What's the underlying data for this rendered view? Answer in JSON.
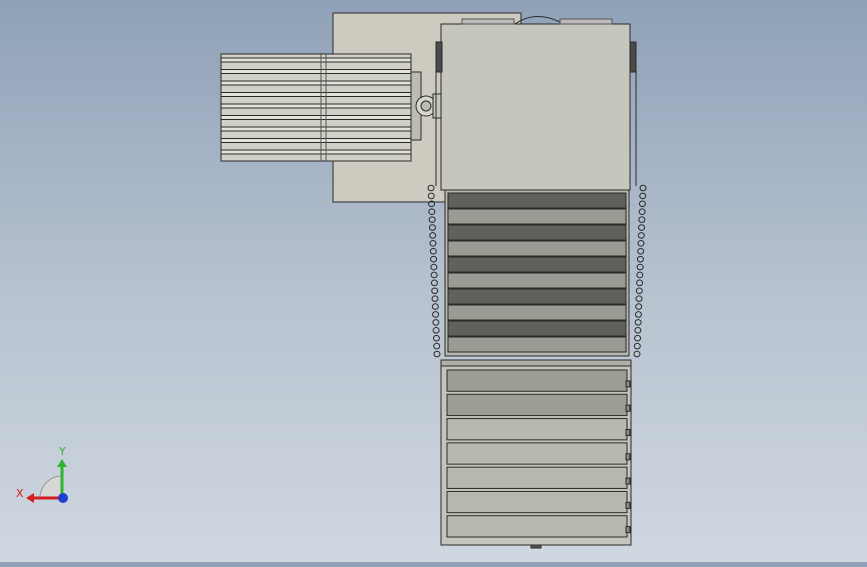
{
  "viewport": {
    "background_top": "#8fa1b8",
    "background_bottom": "#cfd7e0",
    "part_fill": "#c4c4bc",
    "back_plate_fill": "#cdcbc0",
    "edge_color": "#2a2a2a"
  },
  "triad": {
    "x_label": "X",
    "y_label": "Y",
    "x_color": "#d21e1e",
    "y_color": "#2fb52f",
    "z_color": "#1f3fd0"
  },
  "parts": {
    "motor": {
      "fin_count": 9
    },
    "upper_conveyor": {
      "slat_count": 10
    },
    "lower_conveyor": {
      "slat_count": 7
    }
  },
  "cursor": {
    "icon": "mouse-cursor-icon"
  }
}
